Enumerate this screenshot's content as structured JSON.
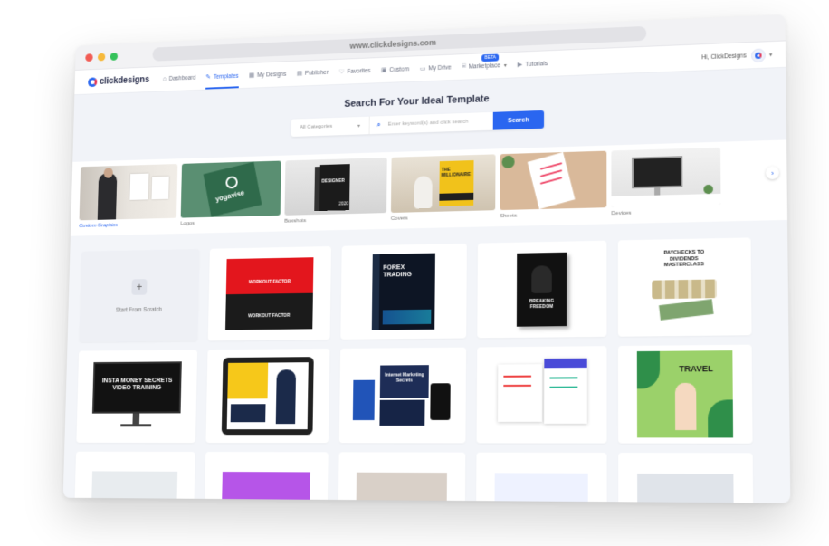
{
  "browser": {
    "url": "www.clickdesigns.com"
  },
  "brand": {
    "name": "clickdesigns",
    "accent": "#2a66f0"
  },
  "nav": {
    "items": [
      {
        "label": "Dashboard",
        "icon": "home-icon"
      },
      {
        "label": "Templates",
        "icon": "templates-icon"
      },
      {
        "label": "My Designs",
        "icon": "grid-icon"
      },
      {
        "label": "Publisher",
        "icon": "calendar-icon"
      },
      {
        "label": "Favorites",
        "icon": "heart-icon"
      },
      {
        "label": "Custom",
        "icon": "custom-icon"
      },
      {
        "label": "My Drive",
        "icon": "folder-icon"
      },
      {
        "label": "Marketplace",
        "icon": "store-icon"
      },
      {
        "label": "Tutorials",
        "icon": "video-icon"
      }
    ],
    "beta_badge": "BETA",
    "user_greeting": "Hi, ClickDesigns"
  },
  "search": {
    "title": "Search For Your Ideal Template",
    "category_selected": "All Categories",
    "placeholder": "Enter keyword(s) and click search",
    "button": "Search"
  },
  "categories": [
    {
      "label": "Custom Graphics"
    },
    {
      "label": "Logos"
    },
    {
      "label": "Boxshots"
    },
    {
      "label": "Covers"
    },
    {
      "label": "Sheets"
    },
    {
      "label": "Devices"
    }
  ],
  "templates": {
    "scratch_label": "Start From Scratch",
    "items": [
      {
        "text": "WORKOUT FACTOR"
      },
      {
        "text": "FOREX TRADING"
      },
      {
        "text": "BREAKING FREEDOM"
      },
      {
        "text": "PAYCHECKS TO DIVIDENDS MASTERCLASS"
      },
      {
        "text": "INSTA MONEY SECRETS VIDEO TRAINING"
      },
      {
        "text": ""
      },
      {
        "text": "Internet Marketing Secrets"
      },
      {
        "text": ""
      },
      {
        "text": "TRAVEL"
      }
    ]
  }
}
